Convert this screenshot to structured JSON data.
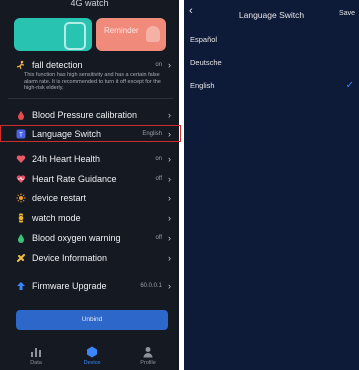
{
  "left": {
    "status_title": "4G watch",
    "cards": {
      "reminder_label": "Reminder"
    },
    "rows": [
      {
        "icon": "fall-icon",
        "label": "fall detection",
        "value": "on",
        "color": "#f0b04a"
      },
      {
        "icon": "blood-pressure-icon",
        "label": "Blood Pressure calibration",
        "value": "",
        "color": "#e84a4a"
      },
      {
        "icon": "language-icon",
        "label": "Language Switch",
        "value": "English",
        "color": "#4a62e8"
      },
      {
        "icon": "heart-icon",
        "label": "24h Heart Health",
        "value": "on",
        "color": "#e85a6a"
      },
      {
        "icon": "heart-guidance-icon",
        "label": "Heart Rate Guidance",
        "value": "off",
        "color": "#e8506a"
      },
      {
        "icon": "restart-icon",
        "label": "device restart",
        "value": "",
        "color": "#f0a028"
      },
      {
        "icon": "watch-icon",
        "label": "watch mode",
        "value": "",
        "color": "#f0b428"
      },
      {
        "icon": "oxygen-icon",
        "label": "Blood oxygen warning",
        "value": "off",
        "color": "#3ac27a"
      },
      {
        "icon": "info-icon",
        "label": "Device Information",
        "value": "",
        "color": "#f0c040"
      },
      {
        "icon": "upgrade-icon",
        "label": "Firmware Upgrade",
        "value": "60.0.0.1",
        "color": "#3a86ff"
      }
    ],
    "fall_description": "This function has high sensitivity and has a certain false alarm rate. It is recommended to turn it off except for the high-risk elderly.",
    "unbind_label": "Unbind",
    "tabs": [
      {
        "label": "Data"
      },
      {
        "label": "Device"
      },
      {
        "label": "Profile"
      }
    ]
  },
  "right": {
    "title": "Language Switch",
    "save_label": "Save",
    "languages": [
      {
        "label": "Español",
        "selected": false
      },
      {
        "label": "Deutsche",
        "selected": false
      },
      {
        "label": "English",
        "selected": true
      }
    ]
  },
  "colors": {
    "accent": "#3a86ff",
    "highlight_border": "#d12b2b",
    "unbind_button": "#2c67c9"
  }
}
